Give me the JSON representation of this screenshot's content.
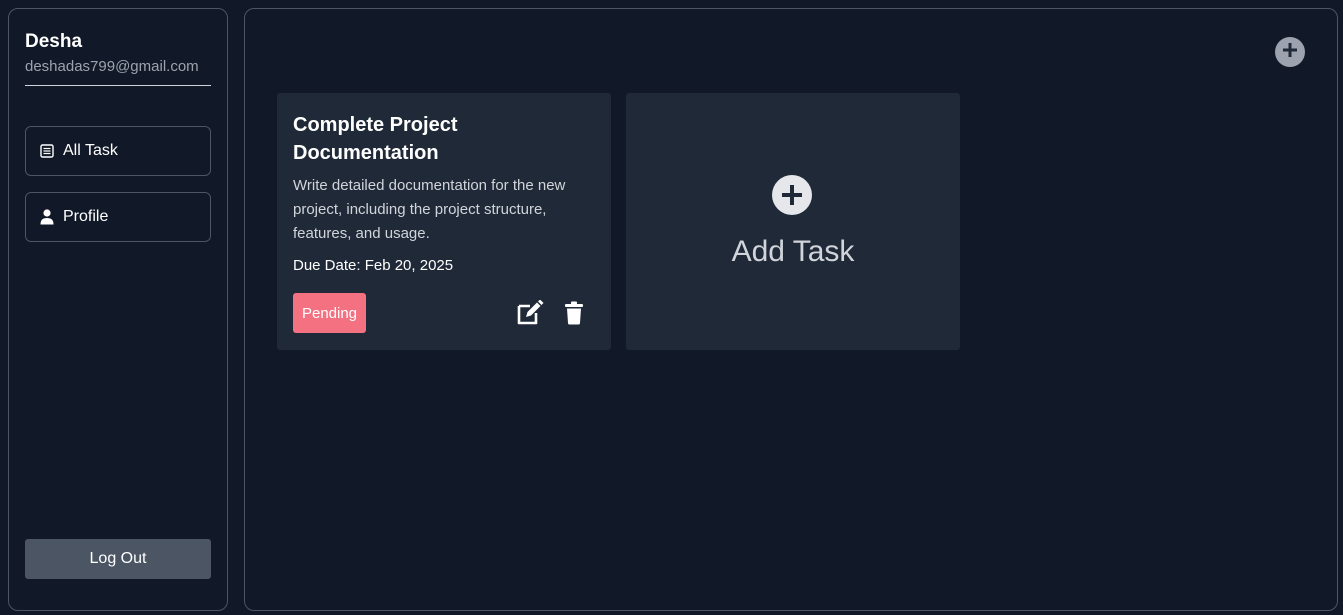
{
  "user": {
    "name": "Desha",
    "email": "deshadas799@gmail.com"
  },
  "sidebar": {
    "items": [
      {
        "label": "All Task",
        "icon": "list-icon"
      },
      {
        "label": "Profile",
        "icon": "user-icon"
      }
    ],
    "logout_label": "Log Out"
  },
  "tasks": [
    {
      "title": "Complete Project Documentation",
      "description": "Write detailed documentation for the new project, including the project structure, features, and usage.",
      "due": "Due Date: Feb 20, 2025",
      "status": "Pending"
    }
  ],
  "add_card": {
    "label": "Add Task"
  },
  "colors": {
    "background": "#111827",
    "card": "#1f2937",
    "border": "#4b5563",
    "pending": "#f47182",
    "logout": "#4b5563"
  }
}
